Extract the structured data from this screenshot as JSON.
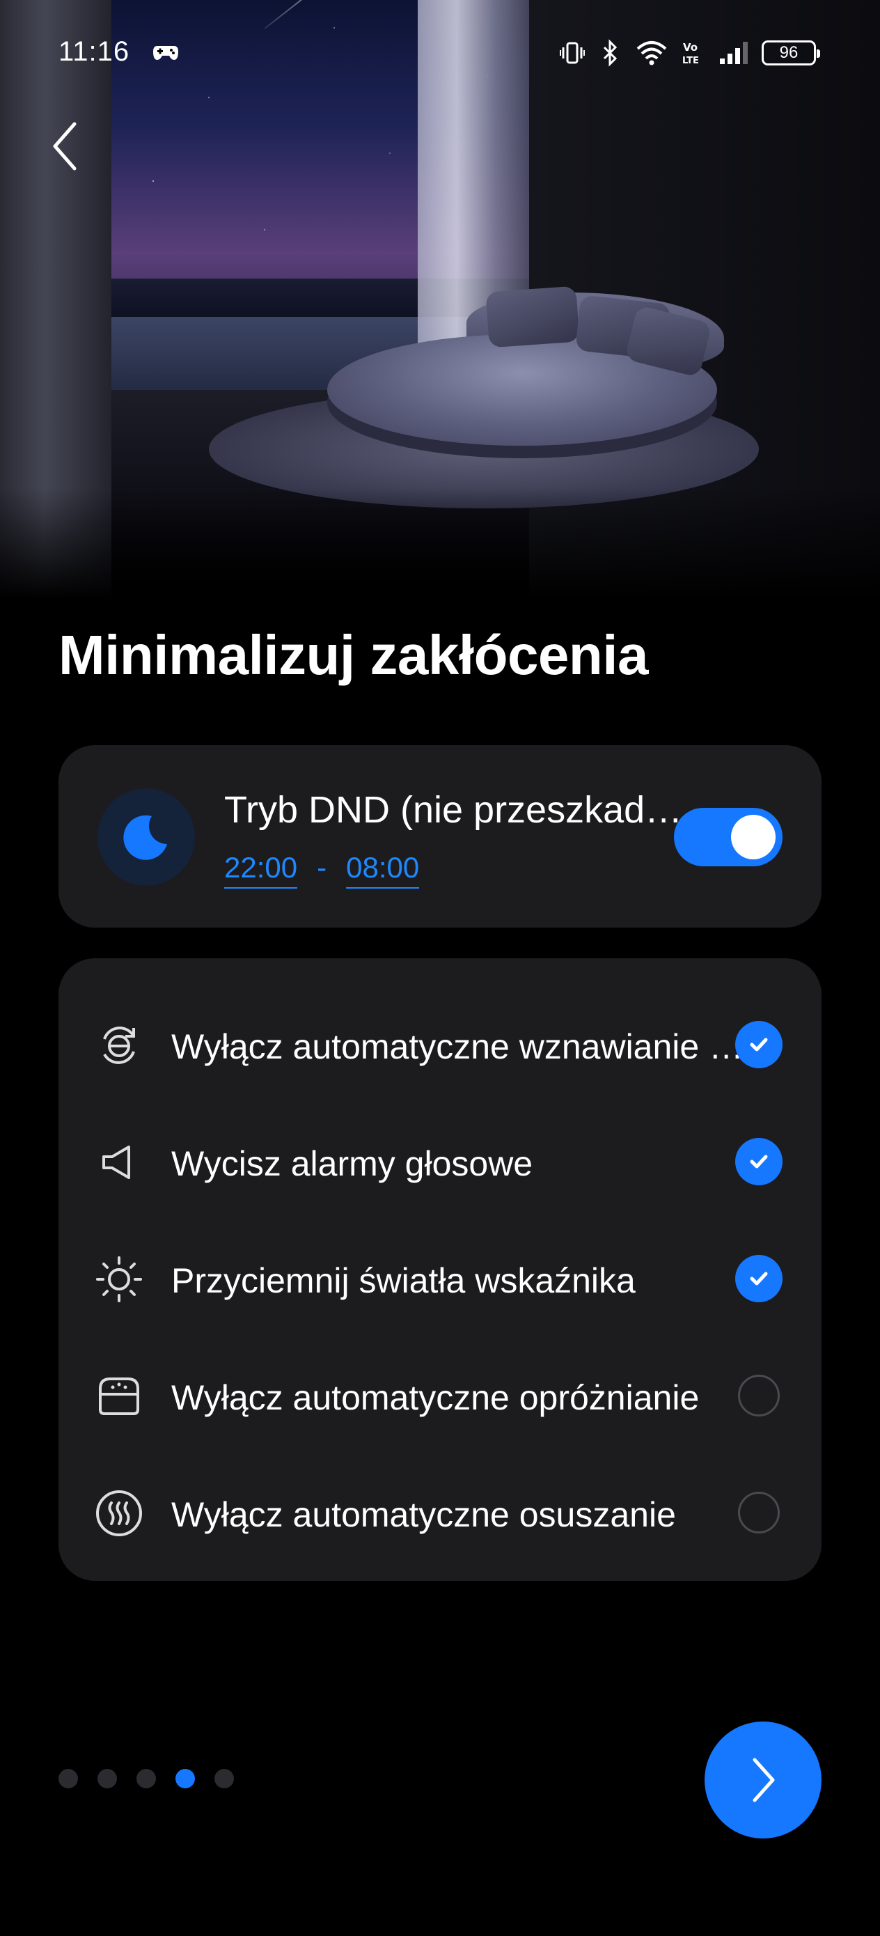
{
  "status_bar": {
    "time": "11:16",
    "battery": "96",
    "icons": [
      "game-controller-icon",
      "vibrate-icon",
      "bluetooth-icon",
      "wifi-icon",
      "volte-icon",
      "signal-icon",
      "battery-icon"
    ]
  },
  "header": {
    "back_icon": "chevron-left-icon"
  },
  "page": {
    "title": "Minimalizuj zakłócenia"
  },
  "dnd": {
    "icon": "moon-icon",
    "title": "Tryb DND (nie przeszkadzać)",
    "start_time": "22:00",
    "separator": "-",
    "end_time": "08:00",
    "enabled": true
  },
  "options": [
    {
      "icon": "auto-resume-icon",
      "label": "Wyłącz automatyczne wznawianie czyszczenia",
      "checked": true
    },
    {
      "icon": "speaker-icon",
      "label": "Wycisz alarmy głosowe",
      "checked": true
    },
    {
      "icon": "sun-icon",
      "label": "Przyciemnij światła wskaźnika",
      "checked": true
    },
    {
      "icon": "dustbin-icon",
      "label": "Wyłącz automatyczne opróżnianie",
      "checked": false
    },
    {
      "icon": "heat-dry-icon",
      "label": "Wyłącz automatyczne osuszanie",
      "checked": false
    }
  ],
  "pager": {
    "count": 5,
    "active_index": 3
  },
  "next_button": {
    "icon": "chevron-right-icon"
  },
  "colors": {
    "accent": "#1677ff",
    "card": "#1c1c1e",
    "background": "#000000"
  }
}
